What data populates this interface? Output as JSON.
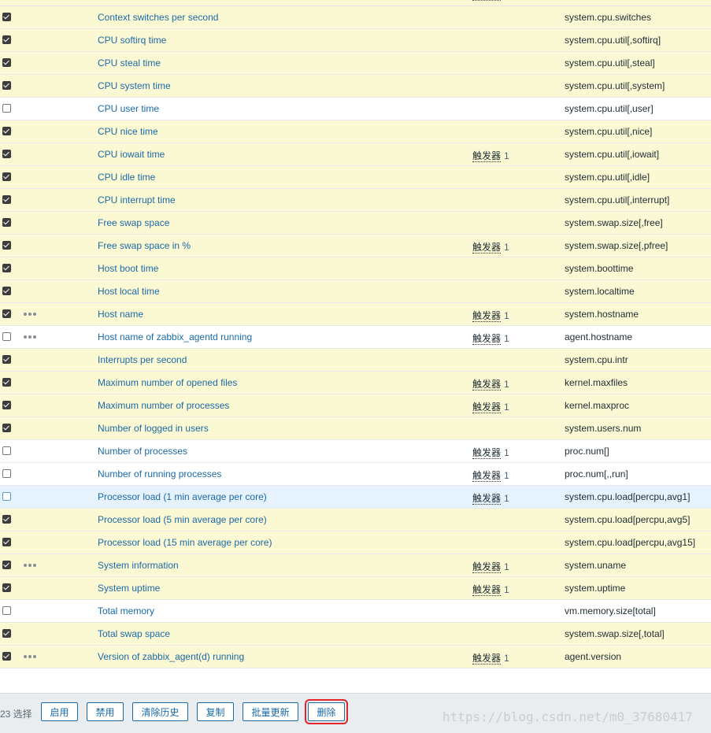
{
  "trigger_label": "触发器",
  "rows": [
    {
      "checked": true,
      "dots": false,
      "name": "Context switches per second",
      "trigger": "",
      "key": "system.cpu.switches"
    },
    {
      "checked": true,
      "dots": false,
      "name": "CPU softirq time",
      "trigger": "",
      "key": "system.cpu.util[,softirq]"
    },
    {
      "checked": true,
      "dots": false,
      "name": "CPU steal time",
      "trigger": "",
      "key": "system.cpu.util[,steal]"
    },
    {
      "checked": true,
      "dots": false,
      "name": "CPU system time",
      "trigger": "",
      "key": "system.cpu.util[,system]"
    },
    {
      "checked": false,
      "dots": false,
      "name": "CPU user time",
      "trigger": "",
      "key": "system.cpu.util[,user]"
    },
    {
      "checked": true,
      "dots": false,
      "name": "CPU nice time",
      "trigger": "",
      "key": "system.cpu.util[,nice]"
    },
    {
      "checked": true,
      "dots": false,
      "name": "CPU iowait time",
      "trigger": "1",
      "key": "system.cpu.util[,iowait]"
    },
    {
      "checked": true,
      "dots": false,
      "name": "CPU idle time",
      "trigger": "",
      "key": "system.cpu.util[,idle]"
    },
    {
      "checked": true,
      "dots": false,
      "name": "CPU interrupt time",
      "trigger": "",
      "key": "system.cpu.util[,interrupt]"
    },
    {
      "checked": true,
      "dots": false,
      "name": "Free swap space",
      "trigger": "",
      "key": "system.swap.size[,free]"
    },
    {
      "checked": true,
      "dots": false,
      "name": "Free swap space in %",
      "trigger": "1",
      "key": "system.swap.size[,pfree]"
    },
    {
      "checked": true,
      "dots": false,
      "name": "Host boot time",
      "trigger": "",
      "key": "system.boottime"
    },
    {
      "checked": true,
      "dots": false,
      "name": "Host local time",
      "trigger": "",
      "key": "system.localtime"
    },
    {
      "checked": true,
      "dots": true,
      "name": "Host name",
      "trigger": "1",
      "key": "system.hostname"
    },
    {
      "checked": false,
      "dots": true,
      "name": "Host name of zabbix_agentd running",
      "trigger": "1",
      "key": "agent.hostname"
    },
    {
      "checked": true,
      "dots": false,
      "name": "Interrupts per second",
      "trigger": "",
      "key": "system.cpu.intr"
    },
    {
      "checked": true,
      "dots": false,
      "name": "Maximum number of opened files",
      "trigger": "1",
      "key": "kernel.maxfiles"
    },
    {
      "checked": true,
      "dots": false,
      "name": "Maximum number of processes",
      "trigger": "1",
      "key": "kernel.maxproc"
    },
    {
      "checked": true,
      "dots": false,
      "name": "Number of logged in users",
      "trigger": "",
      "key": "system.users.num"
    },
    {
      "checked": false,
      "dots": false,
      "name": "Number of processes",
      "trigger": "1",
      "key": "proc.num[]"
    },
    {
      "checked": false,
      "dots": false,
      "name": "Number of running processes",
      "trigger": "1",
      "key": "proc.num[,,run]"
    },
    {
      "checked": false,
      "dots": false,
      "name": "Processor load (1 min average per core)",
      "trigger": "1",
      "key": "system.cpu.load[percpu,avg1]",
      "highlight": true
    },
    {
      "checked": true,
      "dots": false,
      "name": "Processor load (5 min average per core)",
      "trigger": "",
      "key": "system.cpu.load[percpu,avg5]"
    },
    {
      "checked": true,
      "dots": false,
      "name": "Processor load (15 min average per core)",
      "trigger": "",
      "key": "system.cpu.load[percpu,avg15]"
    },
    {
      "checked": true,
      "dots": true,
      "name": "System information",
      "trigger": "1",
      "key": "system.uname"
    },
    {
      "checked": true,
      "dots": false,
      "name": "System uptime",
      "trigger": "1",
      "key": "system.uptime"
    },
    {
      "checked": false,
      "dots": false,
      "name": "Total memory",
      "trigger": "",
      "key": "vm.memory.size[total]"
    },
    {
      "checked": true,
      "dots": false,
      "name": "Total swap space",
      "trigger": "",
      "key": "system.swap.size[,total]"
    },
    {
      "checked": true,
      "dots": true,
      "name": "Version of zabbix_agent(d) running",
      "trigger": "1",
      "key": "agent.version"
    }
  ],
  "footer": {
    "selected_count": "23 选择",
    "buttons": {
      "enable": "启用",
      "disable": "禁用",
      "clear_history": "清除历史",
      "copy": "复制",
      "mass_update": "批量更新",
      "delete": "删除"
    },
    "watermark": "https://blog.csdn.net/m0_37680417"
  },
  "colors": {
    "row_checked": "#fbf8d4",
    "row_highlight": "#e6f2fd",
    "link": "#1b6aa5",
    "delete_frame": "#e0262a"
  }
}
